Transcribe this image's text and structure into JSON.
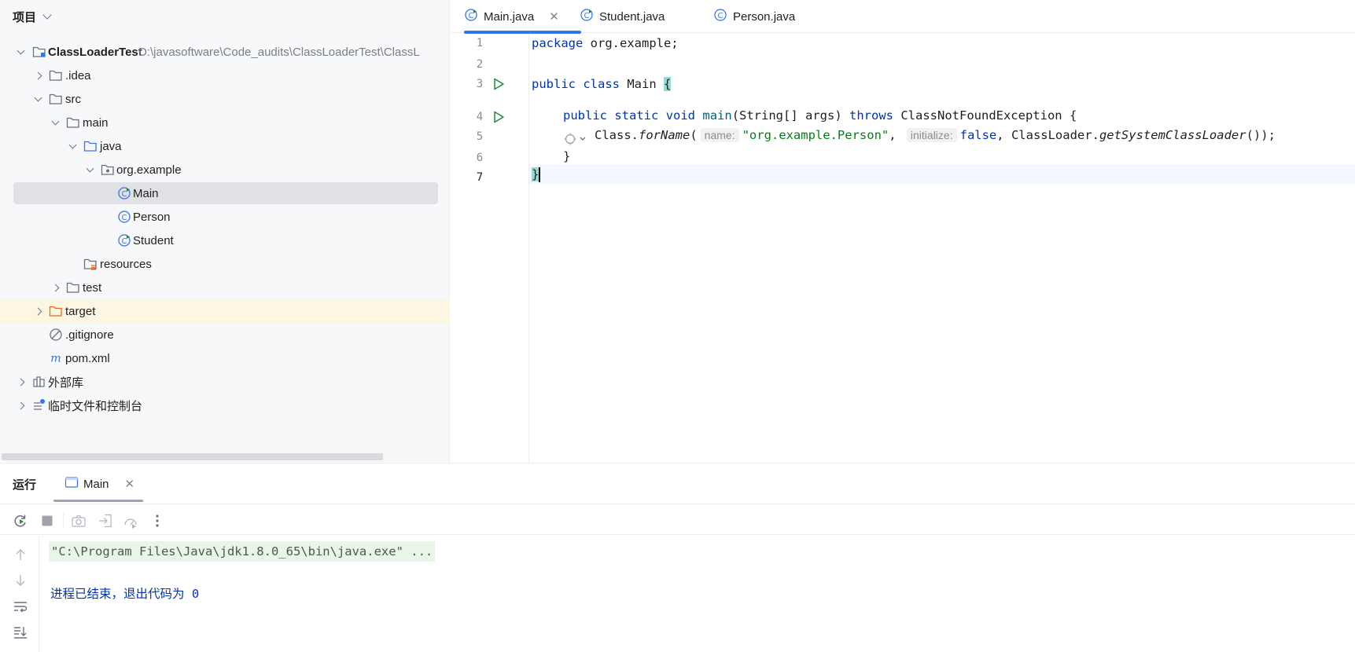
{
  "project_panel": {
    "title": "项目",
    "tree": [
      {
        "label": "ClassLoaderTest",
        "path": "D:\\javasoftware\\Code_audits\\ClassLoaderTest\\ClassL",
        "icon": "module-folder-icon",
        "expanded": true
      },
      {
        "label": ".idea",
        "icon": "folder-icon",
        "expanded": false
      },
      {
        "label": "src",
        "icon": "folder-icon",
        "expanded": true
      },
      {
        "label": "main",
        "icon": "folder-icon",
        "expanded": true
      },
      {
        "label": "java",
        "icon": "source-folder-icon",
        "expanded": true
      },
      {
        "label": "org.example",
        "icon": "package-icon",
        "expanded": true
      },
      {
        "label": "Main",
        "icon": "runnable-class-icon",
        "selected": true
      },
      {
        "label": "Person",
        "icon": "class-icon"
      },
      {
        "label": "Student",
        "icon": "runnable-class-icon"
      },
      {
        "label": "resources",
        "icon": "resources-folder-icon"
      },
      {
        "label": "test",
        "icon": "folder-icon",
        "expanded": false
      },
      {
        "label": "target",
        "icon": "excluded-folder-icon",
        "expanded": false,
        "highlighted": true
      },
      {
        "label": ".gitignore",
        "icon": "ignore-file-icon"
      },
      {
        "label": "pom.xml",
        "icon": "maven-icon"
      },
      {
        "label": "外部库",
        "icon": "library-icon",
        "expanded": false
      },
      {
        "label": "临时文件和控制台",
        "icon": "scratches-icon",
        "expanded": false
      }
    ]
  },
  "editor": {
    "tabs": [
      {
        "label": "Main.java",
        "icon": "runnable-class-icon",
        "active": true
      },
      {
        "label": "Student.java",
        "icon": "runnable-class-icon"
      },
      {
        "label": "Person.java",
        "icon": "class-icon"
      }
    ],
    "line_numbers": [
      "1",
      "2",
      "3",
      "4",
      "5",
      "6",
      "7"
    ],
    "code": {
      "l1_kw": "package",
      "l1_rest": " org.example;",
      "l3_kw1": "public",
      "l3_kw2": "class",
      "l3_name": " Main ",
      "l3_brace": "{",
      "l4_kw1": "public",
      "l4_kw2": "static",
      "l4_kw3": "void",
      "l4_fn": "main",
      "l4_params": "(String[] args) ",
      "l4_throws": "throws",
      "l4_rest": " ClassNotFoundException {",
      "l5_class": "Class.",
      "l5_method": "forName",
      "l5_paren": "(",
      "l5_hint_name": "name:",
      "l5_str": "\"org.example.Person\"",
      "l5_comma": ", ",
      "l5_hint_init": "initialize:",
      "l5_false": "false",
      "l5_loader": ", ClassLoader.",
      "l5_method2": "getSystemClassLoader",
      "l5_end": "());",
      "l6": "}",
      "l7": "}"
    }
  },
  "run_panel": {
    "title": "运行",
    "tab_label": "Main",
    "console_command": "\"C:\\Program Files\\Java\\jdk1.8.0_65\\bin\\java.exe\" ...",
    "console_exit": "进程已结束，退出代码为 0"
  }
}
